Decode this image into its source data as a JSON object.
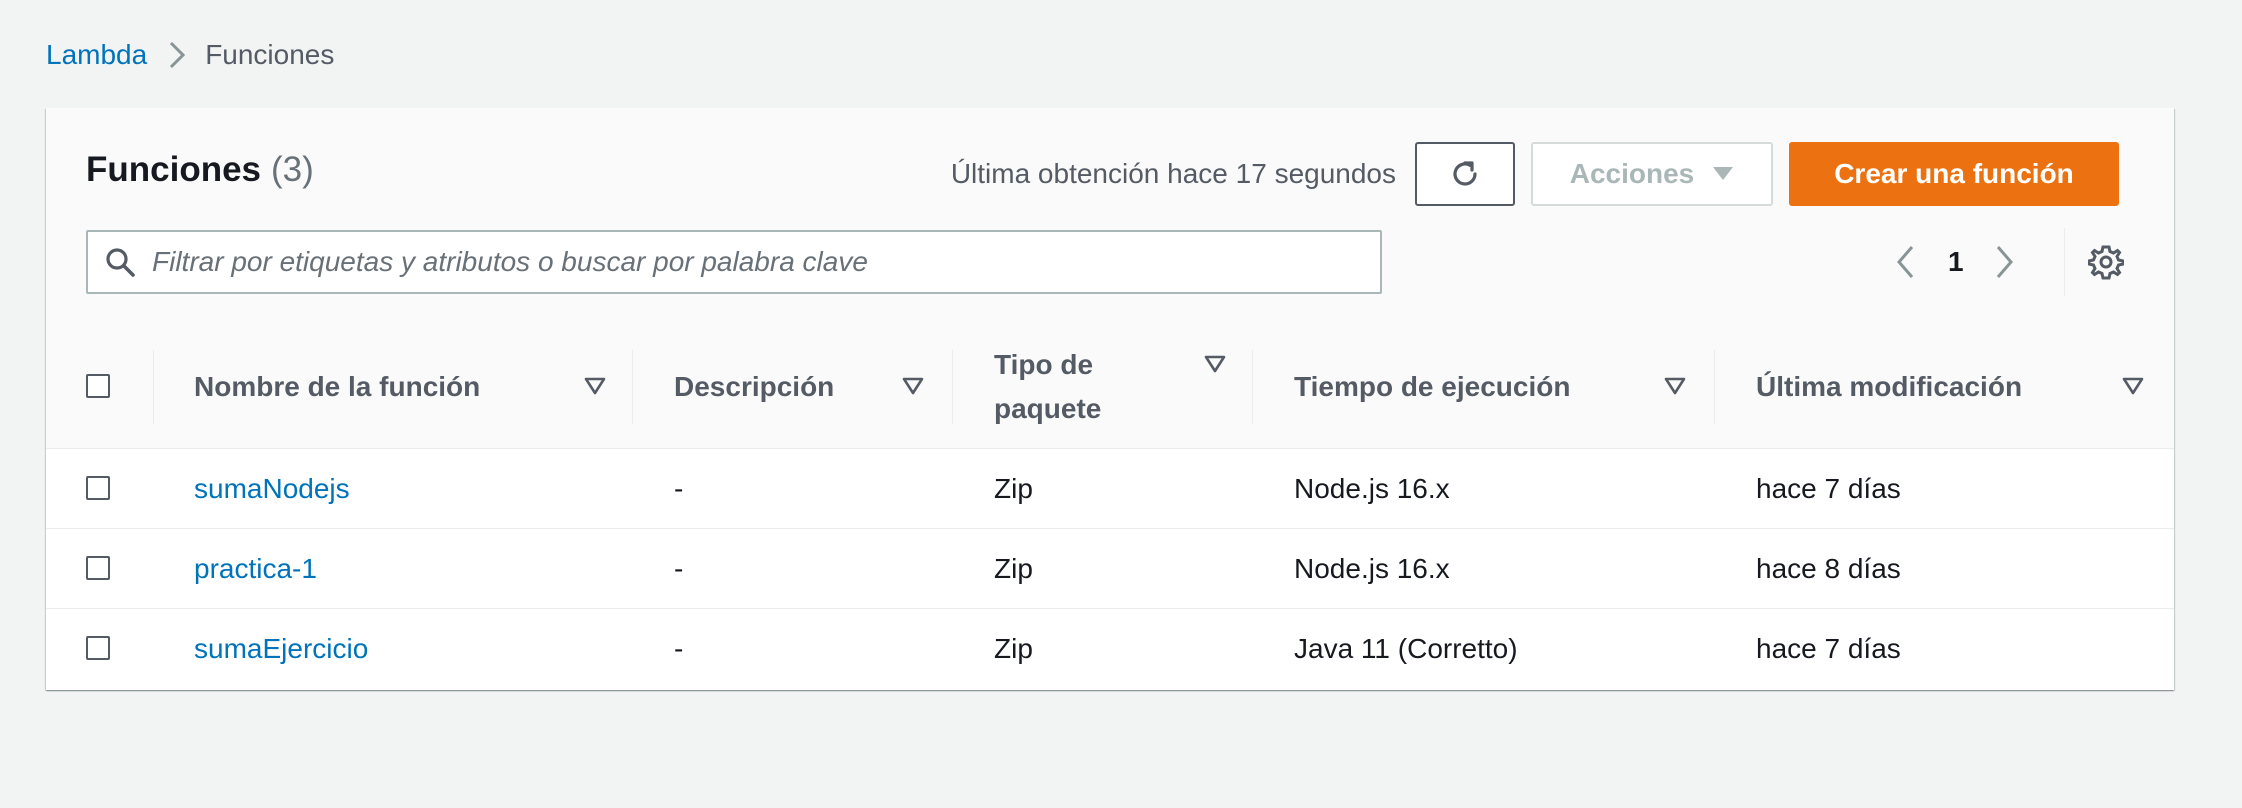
{
  "breadcrumb": {
    "parent": "Lambda",
    "current": "Funciones"
  },
  "panel": {
    "title": "Funciones",
    "count": "(3)",
    "last_fetch": "Última obtención hace 17 segundos",
    "refresh_icon": "refresh-icon",
    "actions_label": "Acciones",
    "create_label": "Crear una función"
  },
  "search": {
    "placeholder": "Filtrar por etiquetas y atributos o buscar por palabra clave",
    "value": ""
  },
  "pagination": {
    "current_page": "1"
  },
  "table": {
    "columns": {
      "name": "Nombre de la función",
      "description": "Descripción",
      "package_type": "Tipo de paquete",
      "runtime": "Tiempo de ejecución",
      "last_modified": "Última modificación"
    },
    "rows": [
      {
        "name": "sumaNodejs",
        "description": "-",
        "package_type": "Zip",
        "runtime": "Node.js 16.x",
        "last_modified": "hace 7 días"
      },
      {
        "name": "practica-1",
        "description": "-",
        "package_type": "Zip",
        "runtime": "Node.js 16.x",
        "last_modified": "hace 8 días"
      },
      {
        "name": "sumaEjercicio",
        "description": "-",
        "package_type": "Zip",
        "runtime": "Java 11 (Corretto)",
        "last_modified": "hace 7 días"
      }
    ]
  },
  "colors": {
    "accent": "#ec7211",
    "link": "#0073bb",
    "background": "#f2f3f3"
  }
}
